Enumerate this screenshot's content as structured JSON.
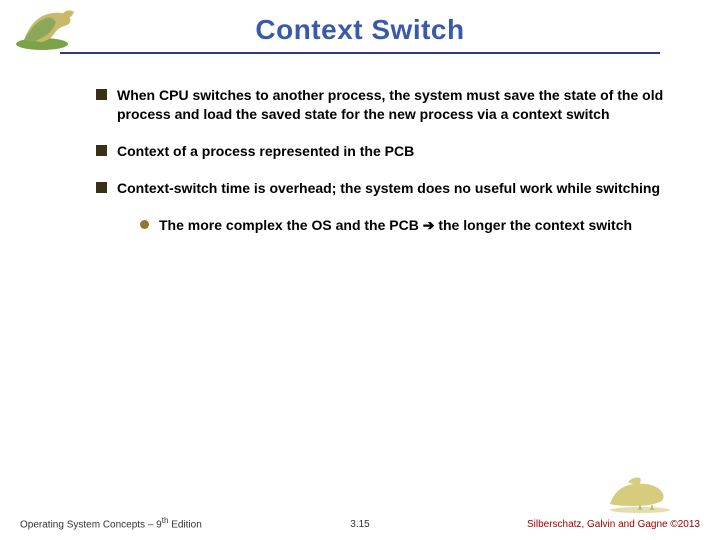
{
  "title": "Context Switch",
  "bullets": [
    {
      "parts": [
        "When CPU switches to another process, the system must ",
        "save the state",
        " of the old process and load the ",
        "saved state",
        " for the new process via a ",
        "context switch"
      ]
    },
    {
      "parts": [
        "",
        "Context",
        " of a process represented in the PCB"
      ]
    },
    {
      "parts": [
        "Context-switch time is overhead; the system does no useful work while switching"
      ]
    }
  ],
  "sub_bullet": {
    "pre": "The more complex the OS and the PCB ",
    "arrow": "➔",
    "post": " the longer the context switch"
  },
  "footer": {
    "left_a": "Operating System Concepts – 9",
    "left_sup": "th",
    "left_b": " Edition",
    "page": "3.15",
    "right": "Silberschatz, Galvin and Gagne ©2013"
  }
}
